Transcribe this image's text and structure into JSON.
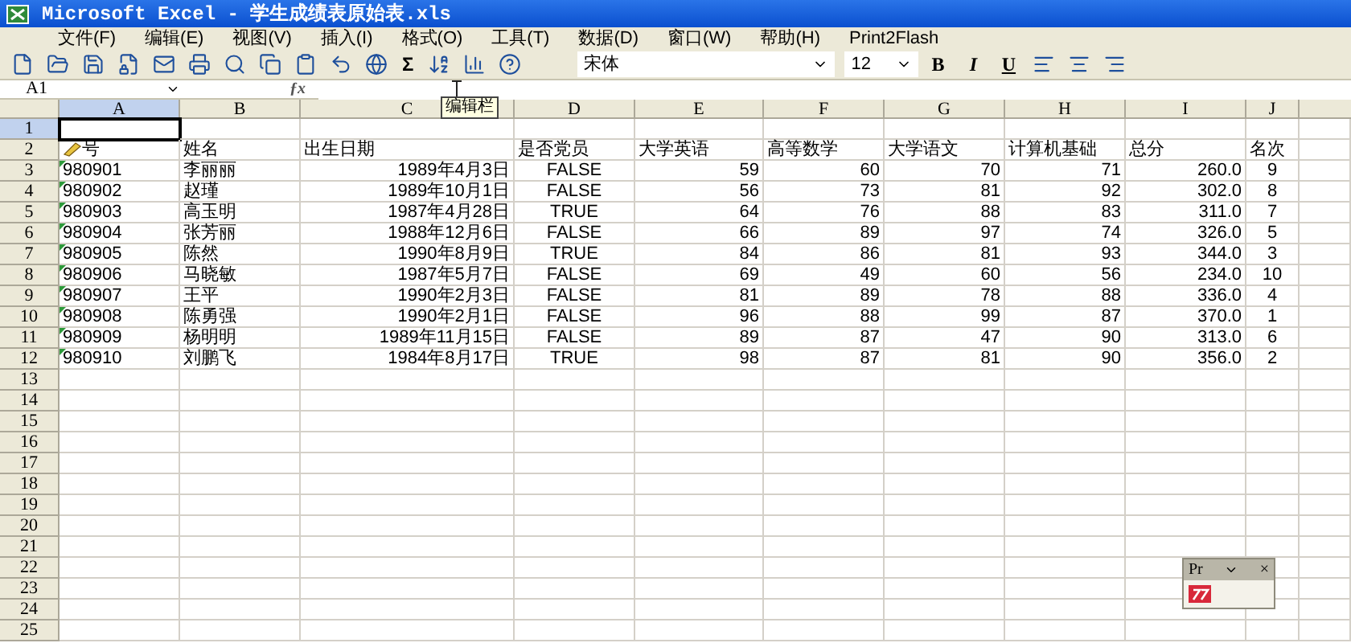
{
  "window": {
    "title": "Microsoft Excel - 学生成绩表原始表.xls"
  },
  "menu": [
    "文件(F)",
    "编辑(E)",
    "视图(V)",
    "插入(I)",
    "格式(O)",
    "工具(T)",
    "数据(D)",
    "窗口(W)",
    "帮助(H)",
    "Print2Flash"
  ],
  "toolbar": {
    "sum": "Σ",
    "font": "宋体",
    "size": "12",
    "format_buttons": [
      "B",
      "I",
      "U"
    ]
  },
  "formula_bar": {
    "name_box": "A1",
    "function_label": "ƒx",
    "tooltip": "编辑栏"
  },
  "columns": [
    {
      "label": "A",
      "selected": true
    },
    {
      "label": "B",
      "selected": false
    },
    {
      "label": "C",
      "selected": false
    },
    {
      "label": "D",
      "selected": false
    },
    {
      "label": "E",
      "selected": false
    },
    {
      "label": "F",
      "selected": false
    },
    {
      "label": "G",
      "selected": false
    },
    {
      "label": "H",
      "selected": false
    },
    {
      "label": "I",
      "selected": false
    },
    {
      "label": "J",
      "selected": false
    }
  ],
  "rows": [
    {
      "header": "1",
      "selected": true,
      "text_number": false,
      "cells": []
    },
    {
      "header": "2",
      "selected": false,
      "text_number": false,
      "cells": [
        "号",
        "姓名",
        "出生日期",
        "是否党员",
        "大学英语",
        "高等数学",
        "大学语文",
        "计算机基础",
        "总分",
        "名次"
      ]
    },
    {
      "header": "3",
      "selected": false,
      "text_number": true,
      "cells": [
        "980901",
        "李丽丽",
        "1989年4月3日",
        "FALSE",
        "59",
        "60",
        "70",
        "71",
        "260.0",
        "9"
      ]
    },
    {
      "header": "4",
      "selected": false,
      "text_number": true,
      "cells": [
        "980902",
        "赵瑾",
        "1989年10月1日",
        "FALSE",
        "56",
        "73",
        "81",
        "92",
        "302.0",
        "8"
      ]
    },
    {
      "header": "5",
      "selected": false,
      "text_number": true,
      "cells": [
        "980903",
        "高玉明",
        "1987年4月28日",
        "TRUE",
        "64",
        "76",
        "88",
        "83",
        "311.0",
        "7"
      ]
    },
    {
      "header": "6",
      "selected": false,
      "text_number": true,
      "cells": [
        "980904",
        "张芳丽",
        "1988年12月6日",
        "FALSE",
        "66",
        "89",
        "97",
        "74",
        "326.0",
        "5"
      ]
    },
    {
      "header": "7",
      "selected": false,
      "text_number": true,
      "cells": [
        "980905",
        "陈然",
        "1990年8月9日",
        "TRUE",
        "84",
        "86",
        "81",
        "93",
        "344.0",
        "3"
      ]
    },
    {
      "header": "8",
      "selected": false,
      "text_number": true,
      "cells": [
        "980906",
        "马晓敏",
        "1987年5月7日",
        "FALSE",
        "69",
        "49",
        "60",
        "56",
        "234.0",
        "10"
      ]
    },
    {
      "header": "9",
      "selected": false,
      "text_number": true,
      "cells": [
        "980907",
        "王平",
        "1990年2月3日",
        "FALSE",
        "81",
        "89",
        "78",
        "88",
        "336.0",
        "4"
      ]
    },
    {
      "header": "10",
      "selected": false,
      "text_number": true,
      "cells": [
        "980908",
        "陈勇强",
        "1990年2月1日",
        "FALSE",
        "96",
        "88",
        "99",
        "87",
        "370.0",
        "1"
      ]
    },
    {
      "header": "11",
      "selected": false,
      "text_number": true,
      "cells": [
        "980909",
        "杨明明",
        "1989年11月15日",
        "FALSE",
        "89",
        "87",
        "47",
        "90",
        "313.0",
        "6"
      ]
    },
    {
      "header": "12",
      "selected": false,
      "text_number": true,
      "cells": [
        "980910",
        "刘鹏飞",
        "1984年8月17日",
        "TRUE",
        "98",
        "87",
        "81",
        "90",
        "356.0",
        "2"
      ]
    },
    {
      "header": "13",
      "selected": false,
      "text_number": false,
      "cells": []
    },
    {
      "header": "14",
      "selected": false,
      "text_number": false,
      "cells": []
    },
    {
      "header": "15",
      "selected": false,
      "text_number": false,
      "cells": []
    },
    {
      "header": "16",
      "selected": false,
      "text_number": false,
      "cells": []
    },
    {
      "header": "17",
      "selected": false,
      "text_number": false,
      "cells": []
    },
    {
      "header": "18",
      "selected": false,
      "text_number": false,
      "cells": []
    },
    {
      "header": "19",
      "selected": false,
      "text_number": false,
      "cells": []
    },
    {
      "header": "20",
      "selected": false,
      "text_number": false,
      "cells": []
    },
    {
      "header": "21",
      "selected": false,
      "text_number": false,
      "cells": []
    },
    {
      "header": "22",
      "selected": false,
      "text_number": false,
      "cells": []
    },
    {
      "header": "23",
      "selected": false,
      "text_number": false,
      "cells": []
    },
    {
      "header": "24",
      "selected": false,
      "text_number": false,
      "cells": []
    },
    {
      "header": "25",
      "selected": false,
      "text_number": false,
      "cells": []
    }
  ],
  "floating_toolbar": {
    "title": "Pr",
    "close": "×"
  }
}
